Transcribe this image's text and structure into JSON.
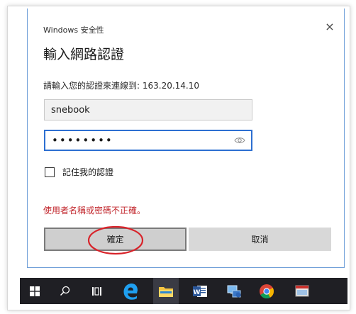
{
  "dialog": {
    "app_title": "Windows 安全性",
    "close_glyph": "×",
    "heading": "輸入網路認證",
    "prompt": "請輸入您的認證來連線到: 163.20.14.10",
    "username_value": "snebook",
    "password_value": "••••••••",
    "remember_label": "記住我的認證",
    "remember_checked": false,
    "error_message": "使用者名稱或密碼不正確。",
    "ok_label": "確定",
    "cancel_label": "取消"
  },
  "colors": {
    "error": "#c2272d",
    "annotation_circle": "#d8232a",
    "focus_border": "#2d6fd1",
    "taskbar": "#1f1f24"
  },
  "taskbar": {
    "items": [
      {
        "icon": "windows-start-icon"
      },
      {
        "icon": "search-icon"
      },
      {
        "icon": "task-view-icon"
      },
      {
        "icon": "edge-browser-icon"
      },
      {
        "icon": "file-explorer-icon"
      },
      {
        "icon": "word-icon"
      },
      {
        "icon": "network-app-icon"
      },
      {
        "icon": "chrome-icon"
      },
      {
        "icon": "window-app-icon"
      }
    ]
  }
}
